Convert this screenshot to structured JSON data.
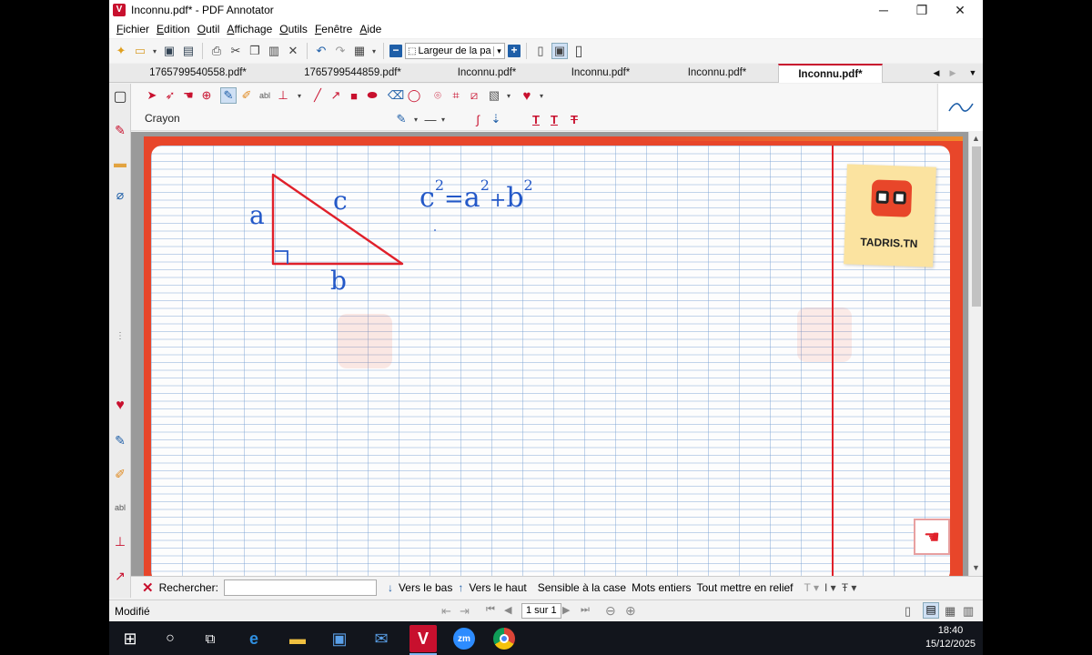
{
  "window": {
    "title": "Inconnu.pdf* - PDF Annotator",
    "minimize": "─",
    "restore": "❐",
    "close": "✕"
  },
  "menu": {
    "items": [
      {
        "first": "F",
        "rest": "ichier"
      },
      {
        "first": "E",
        "rest": "dition"
      },
      {
        "first": "O",
        "rest": "util"
      },
      {
        "first": "A",
        "rest": "ffichage"
      },
      {
        "first": "O",
        "rest": "utils"
      },
      {
        "first": "F",
        "rest": "enêtre"
      },
      {
        "first": "A",
        "rest": "ide"
      }
    ]
  },
  "toolbar": {
    "zoom_value": "Largeur de la pa",
    "zoom_out": "−",
    "zoom_in": "+"
  },
  "tabs": [
    {
      "label": "1765799540558.pdf*"
    },
    {
      "label": "1765799544859.pdf*"
    },
    {
      "label": "Inconnu.pdf*"
    },
    {
      "label": "Inconnu.pdf*"
    },
    {
      "label": "Inconnu.pdf*"
    },
    {
      "label": "Inconnu.pdf*",
      "active": true
    }
  ],
  "annotation_toolbar": {
    "current_tool": "Crayon"
  },
  "document": {
    "labels": {
      "side_a": "a",
      "side_b": "b",
      "side_c": "c"
    },
    "equation": {
      "c": "c",
      "eq": "=",
      "a": "a",
      "plus": "+",
      "b": "b",
      "exp": "2"
    },
    "logo_text": "TADRIS.TN",
    "colors": {
      "triangle": "#e0202a",
      "ink": "#2358c8",
      "border": "#e8462a"
    }
  },
  "search": {
    "label": "Rechercher:",
    "value": "",
    "down_label": "Vers le bas",
    "up_label": "Vers le haut",
    "case_label": "Sensible à la case",
    "words_label": "Mots entiers",
    "highlight_label": "Tout mettre en relief"
  },
  "status": {
    "state": "Modifié",
    "page_indicator": "1 sur 1"
  },
  "taskbar": {
    "time": "18:40",
    "date": "15/12/2025",
    "zoom_app_label": "zm"
  }
}
